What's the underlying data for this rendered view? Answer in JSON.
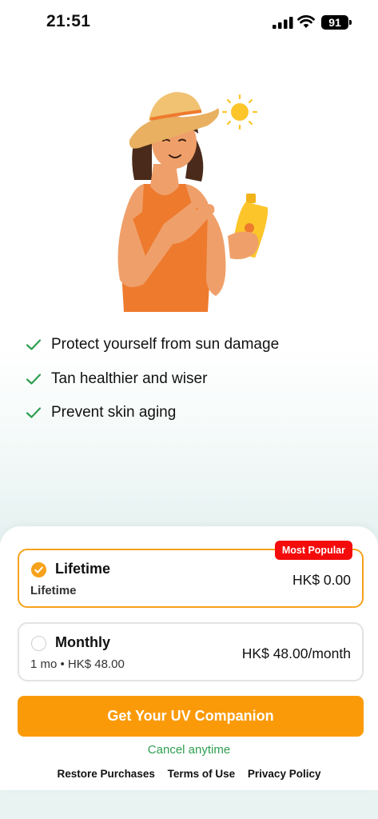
{
  "status_bar": {
    "time": "21:51",
    "battery": "91"
  },
  "hero": {
    "icon": "woman-applying-sunscreen-illustration"
  },
  "features": [
    {
      "icon": "check-icon",
      "text": "Protect yourself from sun damage"
    },
    {
      "icon": "check-icon",
      "text": "Tan healthier and wiser"
    },
    {
      "icon": "check-icon",
      "text": "Prevent skin aging"
    }
  ],
  "plans": {
    "lifetime": {
      "name": "Lifetime",
      "subtitle": "Lifetime",
      "price": "HK$ 0.00",
      "badge": "Most Popular",
      "selected": true
    },
    "monthly": {
      "name": "Monthly",
      "subtitle": "1 mo • HK$ 48.00",
      "price": "HK$ 48.00/month",
      "selected": false
    }
  },
  "cta_label": "Get Your UV Companion",
  "cancel_text": "Cancel anytime",
  "footer": {
    "restore": "Restore Purchases",
    "terms": "Terms of Use",
    "privacy": "Privacy Policy"
  },
  "colors": {
    "accent": "#fb9a09",
    "selected_border": "#f7a21b",
    "badge": "#f40b0b",
    "check": "#2e9e4f"
  }
}
